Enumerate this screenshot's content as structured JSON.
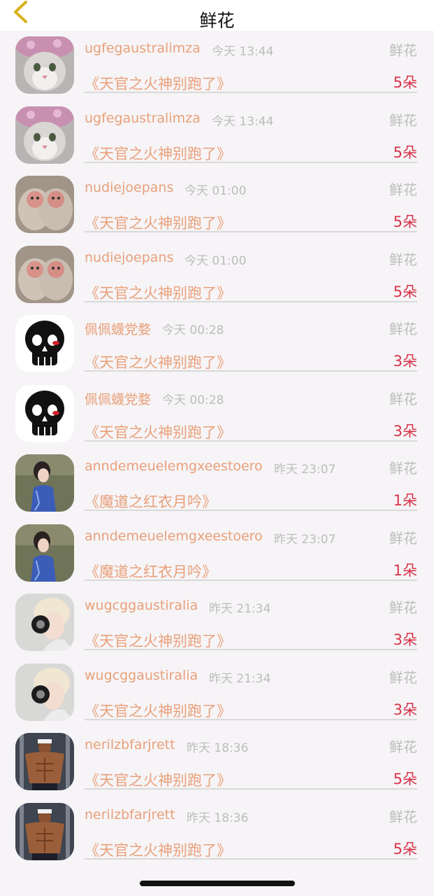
{
  "header": {
    "title": "鲜花"
  },
  "rows": [
    {
      "user": "ugfegaustralimza",
      "time": "今天 13:44",
      "gift": "鲜花",
      "book": "《天官之火神别跑了》",
      "count": "5朵",
      "avatar": "cat"
    },
    {
      "user": "ugfegaustralimza",
      "time": "今天 13:44",
      "gift": "鲜花",
      "book": "《天官之火神别跑了》",
      "count": "5朵",
      "avatar": "cat"
    },
    {
      "user": "nudiejoepans",
      "time": "今天 01:00",
      "gift": "鲜花",
      "book": "《天官之火神别跑了》",
      "count": "5朵",
      "avatar": "monkeys"
    },
    {
      "user": "nudiejoepans",
      "time": "今天 01:00",
      "gift": "鲜花",
      "book": "《天官之火神别跑了》",
      "count": "5朵",
      "avatar": "monkeys"
    },
    {
      "user": "佩佩蠛党婺",
      "time": "今天 00:28",
      "gift": "鲜花",
      "book": "《天官之火神别跑了》",
      "count": "3朵",
      "avatar": "skull"
    },
    {
      "user": "佩佩蠛党婺",
      "time": "今天 00:28",
      "gift": "鲜花",
      "book": "《天官之火神别跑了》",
      "count": "3朵",
      "avatar": "skull"
    },
    {
      "user": "anndemeuelemgxeestoero",
      "time": "昨天 23:07",
      "gift": "鲜花",
      "book": "《魔道之红衣月吟》",
      "count": "1朵",
      "avatar": "woman-qipao"
    },
    {
      "user": "anndemeuelemgxeestoero",
      "time": "昨天 23:07",
      "gift": "鲜花",
      "book": "《魔道之红衣月吟》",
      "count": "1朵",
      "avatar": "woman-qipao"
    },
    {
      "user": "wugcggaustiralia",
      "time": "昨天 21:34",
      "gift": "鲜花",
      "book": "《天官之火神别跑了》",
      "count": "3朵",
      "avatar": "headphones"
    },
    {
      "user": "wugcggaustiralia",
      "time": "昨天 21:34",
      "gift": "鲜花",
      "book": "《天官之火神别跑了》",
      "count": "3朵",
      "avatar": "headphones"
    },
    {
      "user": "nerilzbfarjrett",
      "time": "昨天 18:36",
      "gift": "鲜花",
      "book": "《天官之火神别跑了》",
      "count": "5朵",
      "avatar": "muscle-man"
    },
    {
      "user": "nerilzbfarjrett",
      "time": "昨天 18:36",
      "gift": "鲜花",
      "book": "《天官之火神别跑了》",
      "count": "5朵",
      "avatar": "muscle-man"
    }
  ],
  "colors": {
    "accent": "#e9a07b",
    "count": "#d8334a",
    "muted": "#bdbdbd",
    "back": "#d9b21e"
  }
}
